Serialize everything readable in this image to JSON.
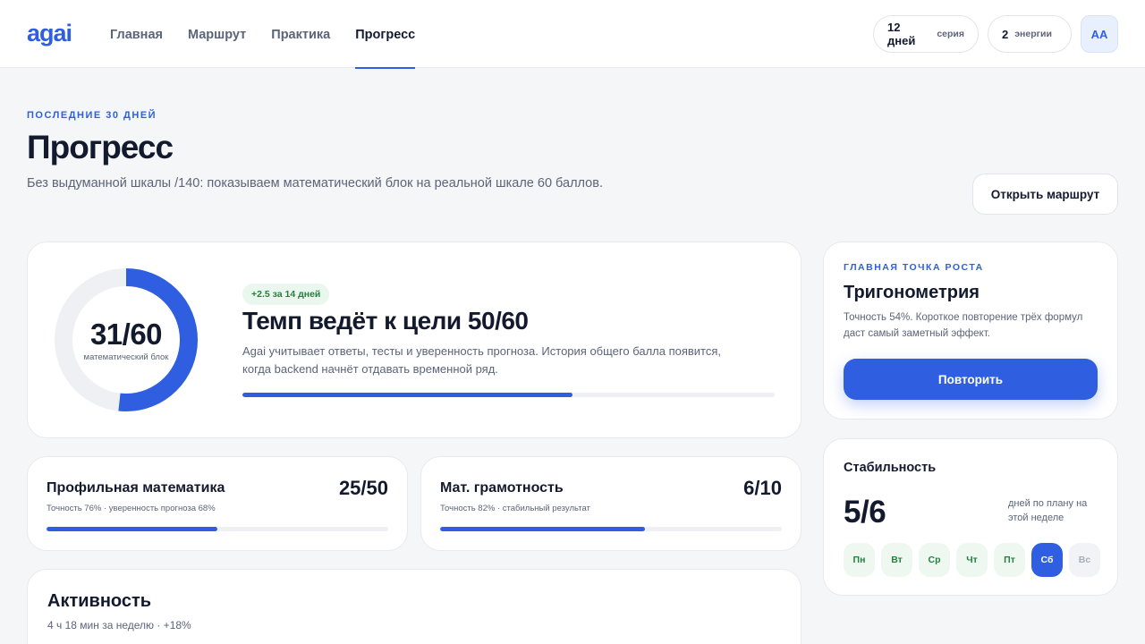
{
  "app": {
    "logo": "agai"
  },
  "nav": {
    "items": [
      {
        "label": "Главная"
      },
      {
        "label": "Маршрут"
      },
      {
        "label": "Практика"
      },
      {
        "label": "Прогресс"
      }
    ]
  },
  "header": {
    "streak_value": "12 дней",
    "streak_label": "серия",
    "energy_value": "2",
    "energy_label": "энергии",
    "avatar_initials": "AA"
  },
  "page": {
    "eyebrow": "ПОСЛЕДНИЕ 30 ДНЕЙ",
    "title": "Прогресс",
    "subtitle": "Без выдуманной шкалы /140: показываем математический блок на реальной шкале 60 баллов.",
    "route_button": "Открыть маршрут"
  },
  "main_card": {
    "score": "31/60",
    "score_label": "математический блок",
    "score_fraction": 0.517,
    "trend_badge": "+2.5 за 14 дней",
    "title": "Темп ведёт к цели 50/60",
    "text": "Agai учитывает ответы, тесты и уверенность прогноза. История общего балла появится, когда backend начнёт отдавать временной ряд.",
    "progress_fraction": 0.62
  },
  "subjects": [
    {
      "name": "Профильная математика",
      "score": "25/50",
      "meta": "Точность 76% · уверенность прогноза 68%",
      "progress_fraction": 0.5
    },
    {
      "name": "Мат. грамотность",
      "score": "6/10",
      "meta": "Точность 82% · стабильный результат",
      "progress_fraction": 0.6
    }
  ],
  "activity": {
    "title": "Активность",
    "subtitle": "4 ч 18 мин за неделю · +18%"
  },
  "growth": {
    "eyebrow": "ГЛАВНАЯ ТОЧКА РОСТА",
    "title": "Тригонометрия",
    "text": "Точность 54%. Короткое повторение трёх формул даст самый заметный эффект.",
    "button": "Повторить"
  },
  "stability": {
    "title": "Стабильность",
    "value": "5/6",
    "caption": "дней по плану на этой неделе",
    "days": [
      "Пн",
      "Вт",
      "Ср",
      "Чт",
      "Пт",
      "Сб",
      "Вс"
    ]
  },
  "colors": {
    "accent": "#2f5fe0",
    "success": "#23803f",
    "success_bg": "#eaf7ee"
  }
}
